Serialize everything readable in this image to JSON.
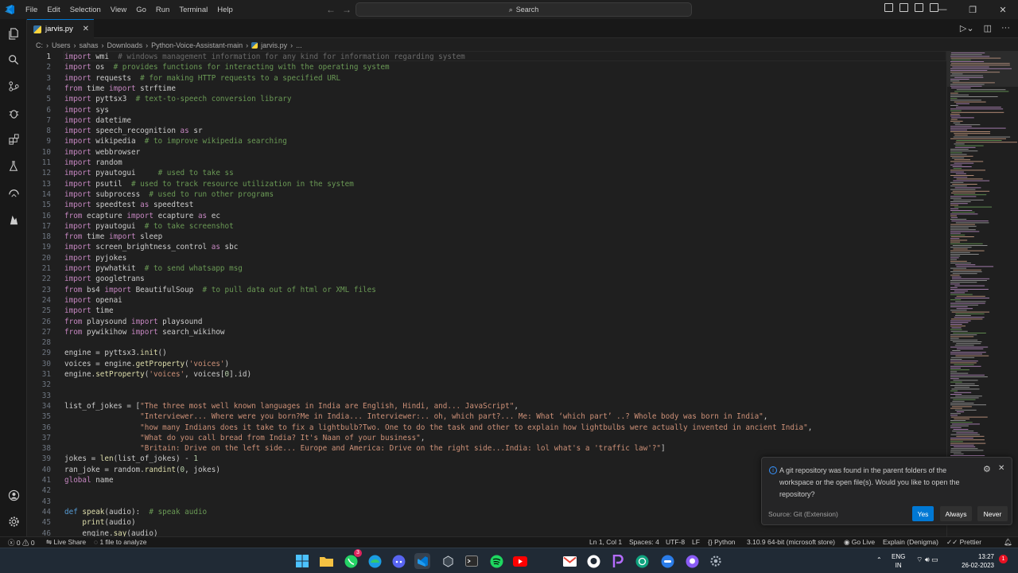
{
  "menu": [
    "File",
    "Edit",
    "Selection",
    "View",
    "Go",
    "Run",
    "Terminal",
    "Help"
  ],
  "search": {
    "label": "Search"
  },
  "tab": {
    "filename": "jarvis.py"
  },
  "breadcrumb": [
    "C:",
    "Users",
    "sahas",
    "Downloads",
    "Python-Voice-Assistant-main",
    "jarvis.py",
    "..."
  ],
  "code_lines": [
    {
      "n": "1",
      "h": "<span class=\"kw\">import</span> wmi  <span class=\"cmr\"># windows management information for any kind for information regarding system</span>"
    },
    {
      "n": "2",
      "h": "<span class=\"kw\">import</span> os  <span class=\"cm\"># provides functions for interacting with the operating system</span>"
    },
    {
      "n": "3",
      "h": "<span class=\"kw\">import</span> requests  <span class=\"cm\"># for making HTTP requests to a specified URL</span>"
    },
    {
      "n": "4",
      "h": "<span class=\"kw\">from</span> time <span class=\"kw\">import</span> strftime"
    },
    {
      "n": "5",
      "h": "<span class=\"kw\">import</span> pyttsx3  <span class=\"cm\"># text-to-speech conversion library</span>"
    },
    {
      "n": "6",
      "h": "<span class=\"kw\">import</span> sys"
    },
    {
      "n": "7",
      "h": "<span class=\"kw\">import</span> datetime"
    },
    {
      "n": "8",
      "h": "<span class=\"kw\">import</span> speech_recognition <span class=\"kw\">as</span> sr"
    },
    {
      "n": "9",
      "h": "<span class=\"kw\">import</span> wikipedia  <span class=\"cm\"># to improve wikipedia searching</span>"
    },
    {
      "n": "10",
      "h": "<span class=\"kw\">import</span> webbrowser"
    },
    {
      "n": "11",
      "h": "<span class=\"kw\">import</span> random"
    },
    {
      "n": "12",
      "h": "<span class=\"kw\">import</span> pyautogui     <span class=\"cm\"># used to take ss</span>"
    },
    {
      "n": "13",
      "h": "<span class=\"kw\">import</span> psutil  <span class=\"cm\"># used to track resource utilization in the system</span>"
    },
    {
      "n": "14",
      "h": "<span class=\"kw\">import</span> subprocess  <span class=\"cm\"># used to run other programs</span>"
    },
    {
      "n": "15",
      "h": "<span class=\"kw\">import</span> speedtest <span class=\"kw\">as</span> speedtest"
    },
    {
      "n": "16",
      "h": "<span class=\"kw\">from</span> ecapture <span class=\"kw\">import</span> ecapture <span class=\"kw\">as</span> ec"
    },
    {
      "n": "17",
      "h": "<span class=\"kw\">import</span> pyautogui  <span class=\"cm\"># to take screenshot</span>"
    },
    {
      "n": "18",
      "h": "<span class=\"kw\">from</span> time <span class=\"kw\">import</span> sleep"
    },
    {
      "n": "19",
      "h": "<span class=\"kw\">import</span> screen_brightness_control <span class=\"kw\">as</span> sbc"
    },
    {
      "n": "20",
      "h": "<span class=\"kw\">import</span> pyjokes"
    },
    {
      "n": "21",
      "h": "<span class=\"kw\">import</span> pywhatkit  <span class=\"cm\"># to send whatsapp msg</span>"
    },
    {
      "n": "22",
      "h": "<span class=\"kw\">import</span> googletrans"
    },
    {
      "n": "23",
      "h": "<span class=\"kw\">from</span> bs4 <span class=\"kw\">import</span> BeautifulSoup  <span class=\"cm\"># to pull data out of html or XML files</span>"
    },
    {
      "n": "24",
      "h": "<span class=\"kw\">import</span> openai"
    },
    {
      "n": "25",
      "h": "<span class=\"kw\">import</span> time"
    },
    {
      "n": "26",
      "h": "<span class=\"kw\">from</span> playsound <span class=\"kw\">import</span> playsound"
    },
    {
      "n": "27",
      "h": "<span class=\"kw\">from</span> pywikihow <span class=\"kw\">import</span> search_wikihow"
    },
    {
      "n": "28",
      "h": ""
    },
    {
      "n": "29",
      "h": "engine = pyttsx3.<span class=\"fn\">init</span>()"
    },
    {
      "n": "30",
      "h": "voices = engine.<span class=\"fn\">getProperty</span>(<span class=\"st\">'voices'</span>)"
    },
    {
      "n": "31",
      "h": "engine.<span class=\"fn\">setProperty</span>(<span class=\"st\">'voices'</span>, voices[<span class=\"nm\">0</span>].id)"
    },
    {
      "n": "32",
      "h": ""
    },
    {
      "n": "33",
      "h": ""
    },
    {
      "n": "34",
      "h": "list_of_jokes = [<span class=\"st\">\"The three most well known languages in India are English, Hindi, and... JavaScript\"</span>,"
    },
    {
      "n": "35",
      "h": "                 <span class=\"st\">\"Interviewer... Where were you born?Me in India... Interviewer:.. oh, which part?... Me: What ‘which part’ ..? Whole body was born in India\"</span>,"
    },
    {
      "n": "36",
      "h": "                 <span class=\"st\">\"how many Indians does it take to fix a lightbulb?Two. One to do the task and other to explain how lightbulbs were actually invented in ancient India\"</span>,"
    },
    {
      "n": "37",
      "h": "                 <span class=\"st\">\"What do you call bread from India? It's Naan of your business\"</span>,"
    },
    {
      "n": "38",
      "h": "                 <span class=\"st\">\"Britain: Drive on the left side... Europe and America: Drive on the right side...India: lol what's a 'traffic law'?\"</span>]"
    },
    {
      "n": "39",
      "h": "jokes = <span class=\"fn\">len</span>(list_of_jokes) - <span class=\"nm\">1</span>"
    },
    {
      "n": "40",
      "h": "ran_joke = random.<span class=\"fn\">randint</span>(<span class=\"nm\">0</span>, jokes)"
    },
    {
      "n": "41",
      "h": "<span class=\"kw\">global</span> name"
    },
    {
      "n": "42",
      "h": ""
    },
    {
      "n": "43",
      "h": ""
    },
    {
      "n": "44",
      "h": "<span class=\"df\">def</span> <span class=\"fn\">speak</span>(audio):  <span class=\"cm\"># speak audio</span>"
    },
    {
      "n": "45",
      "h": "    <span class=\"fn\">print</span>(audio)"
    },
    {
      "n": "46",
      "h": "    engine.<span class=\"fn\">say</span>(audio)"
    }
  ],
  "notification": {
    "message": "A git repository was found in the parent folders of the workspace or the open file(s). Would you like to open the repository?",
    "source": "Source: Git (Extension)",
    "yes": "Yes",
    "always": "Always",
    "never": "Never"
  },
  "status": {
    "problems": "0 ⚠ 0",
    "live_share": "Live Share",
    "analyze": "1 file to analyze",
    "position": "Ln 1, Col 1",
    "spaces": "Spaces: 4",
    "encoding": "UTF-8",
    "eol": "LF",
    "language": "Python",
    "interpreter": "3.10.9 64-bit (microsoft store)",
    "go_live": "Go Live",
    "explain": "Explain (Denigma)",
    "prettier": "Prettier"
  },
  "taskbar": {
    "lang_top": "ENG",
    "lang_bottom": "IN",
    "time": "13:27",
    "date": "26-02-2023",
    "whatsapp_badge": "3"
  }
}
